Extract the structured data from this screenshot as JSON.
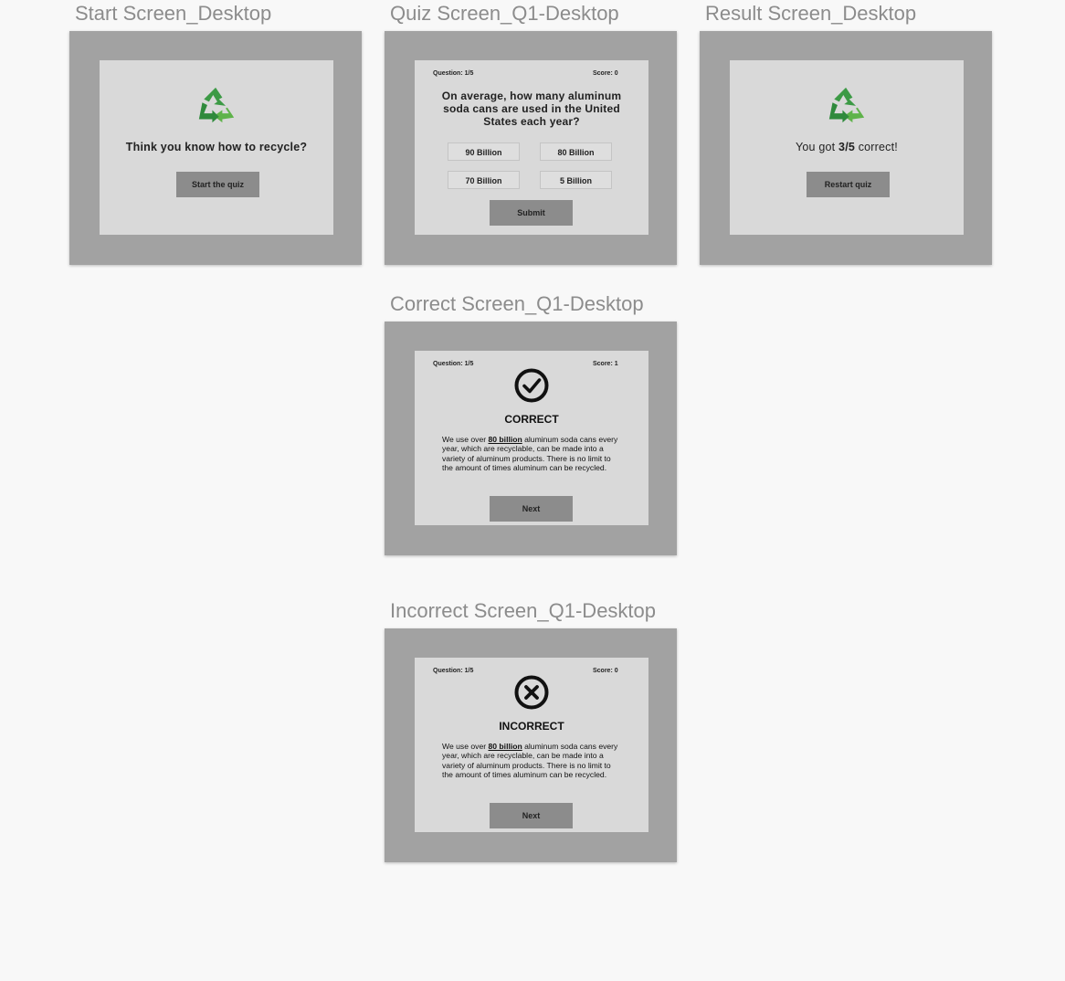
{
  "frames": {
    "start": {
      "title": "Start Screen_Desktop",
      "heading": "Think you know how to recycle?",
      "start_button": "Start the quiz"
    },
    "quiz": {
      "title": "Quiz Screen_Q1-Desktop",
      "question_counter": "Question: 1/5",
      "score": "Score: 0",
      "question": "On average, how many aluminum soda cans are used in the United States each year?",
      "options": [
        "90 Billion",
        "80 Billion",
        "70 Billion",
        "5 Billion"
      ],
      "submit_button": "Submit"
    },
    "result": {
      "title": "Result Screen_Desktop",
      "result_prefix": "You got ",
      "result_score": "3/5",
      "result_suffix": " correct!",
      "restart_button": "Restart quiz"
    },
    "correct": {
      "title": "Correct Screen_Q1-Desktop",
      "question_counter": "Question: 1/5",
      "score": "Score: 1",
      "status": "CORRECT",
      "explain_prefix": "We use over ",
      "explain_highlight": "80 billion",
      "explain_suffix": " aluminum soda cans every year, which are recyclable, can be made into a variety of aluminum products. There is no limit to the amount of times aluminum can be recycled.",
      "next_button": "Next"
    },
    "incorrect": {
      "title": "Incorrect Screen_Q1-Desktop",
      "question_counter": "Question: 1/5",
      "score": "Score: 0",
      "status": "INCORRECT",
      "explain_prefix": "We use over ",
      "explain_highlight": "80 billion",
      "explain_suffix": " aluminum soda cans every year, which are recyclable, can be made into a variety of aluminum products. There is no limit to the amount of times aluminum can be recycled.",
      "next_button": "Next"
    }
  },
  "icons": {
    "recycle": "recycle-icon",
    "check": "check-circle-icon",
    "cross": "x-circle-icon"
  },
  "colors": {
    "canvas": "#f8f8f8",
    "frame": "#a2a2a2",
    "card": "#d9d9d9",
    "button": "#8c8c8c",
    "recycle_green_dark": "#2e8b3e",
    "recycle_green_light": "#6cbf4a"
  }
}
